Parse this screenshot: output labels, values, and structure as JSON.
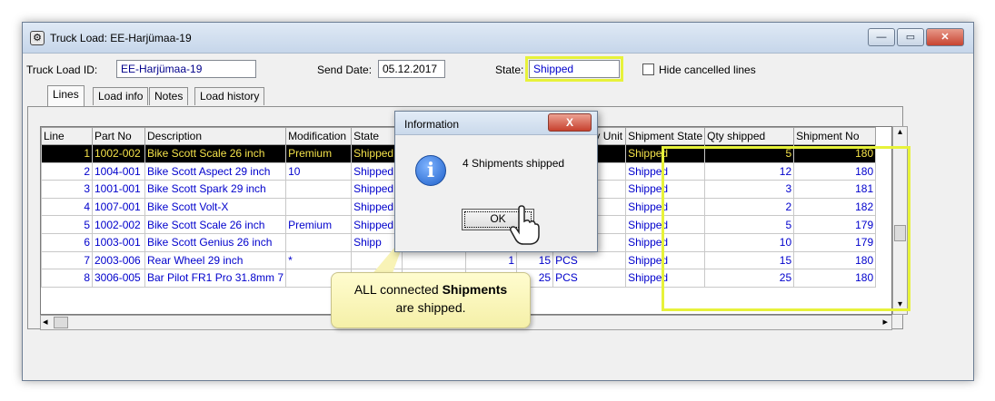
{
  "window": {
    "title": "Truck Load: EE-Harjümaa-19",
    "buttons": {
      "minimize": "—",
      "maximize": "▭",
      "close": "✕"
    }
  },
  "header": {
    "truck_load_id_label": "Truck Load ID:",
    "truck_load_id_value": "EE-Harjümaa-19",
    "send_date_label": "Send Date:",
    "send_date_value": "05.12.2017",
    "state_label": "State:",
    "state_value": "Shipped",
    "hide_cancelled_label": "Hide cancelled lines"
  },
  "tabs": [
    {
      "label": "Lines"
    },
    {
      "label": "Load info"
    },
    {
      "label": "Notes"
    },
    {
      "label": "Load history"
    }
  ],
  "grid": {
    "columns": [
      "Line",
      "Part No",
      "Description",
      "Modification",
      "State",
      "",
      "",
      "",
      "Inventory Unit",
      "Shipment State",
      "Qty shipped",
      "Shipment No"
    ],
    "rows": [
      [
        "1",
        "1002-002",
        "Bike Scott Scale 26 inch",
        "Premium",
        "Shipped",
        "",
        "",
        "",
        "PCS",
        "Shipped",
        "5",
        "180"
      ],
      [
        "2",
        "1004-001",
        "Bike Scott Aspect 29 inch",
        "10",
        "Shipped",
        "",
        "",
        "",
        "PCS",
        "Shipped",
        "12",
        "180"
      ],
      [
        "3",
        "1001-001",
        "Bike Scott Spark 29 inch",
        "",
        "Shipped",
        "",
        "",
        "",
        "PCS",
        "Shipped",
        "3",
        "181"
      ],
      [
        "4",
        "1007-001",
        "Bike Scott Volt-X",
        "",
        "Shipped",
        "",
        "",
        "",
        "PCS",
        "Shipped",
        "2",
        "182"
      ],
      [
        "5",
        "1002-002",
        "Bike Scott Scale 26 inch",
        "Premium",
        "Shipped",
        "",
        "",
        "",
        "PCS",
        "Shipped",
        "5",
        "179"
      ],
      [
        "6",
        "1003-001",
        "Bike Scott Genius 26 inch",
        "",
        "Shipp",
        "10",
        "1",
        "10",
        "PCS",
        "Shipped",
        "10",
        "179"
      ],
      [
        "7",
        "2003-006",
        "Rear Wheel 29 inch",
        "*",
        "",
        "",
        "1",
        "15",
        "PCS",
        "Shipped",
        "15",
        "180"
      ],
      [
        "8",
        "3006-005",
        "Bar Pilot FR1 Pro 31.8mm 7",
        "",
        "",
        "",
        "1",
        "25",
        "PCS",
        "Shipped",
        "25",
        "180"
      ]
    ]
  },
  "dialog": {
    "title": "Information",
    "close_label": "X",
    "icon_glyph": "i",
    "message": "4 Shipments shipped",
    "ok_label": "OK"
  },
  "callout": {
    "text_before": "ALL connected ",
    "text_bold": "Shipments",
    "text_after": "are shipped."
  },
  "scrollbars": {
    "left_arrow": "◂",
    "right_arrow": "▸",
    "up_arrow": "▴",
    "down_arrow": "▾"
  },
  "colors": {
    "highlight": "#e7f23a",
    "selected_row_bg": "#000000",
    "selected_row_text": "#f4e24a",
    "data_text": "#0000cc"
  }
}
